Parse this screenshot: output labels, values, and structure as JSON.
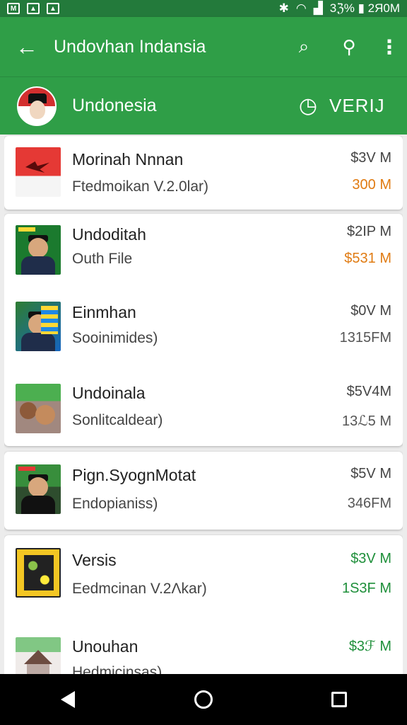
{
  "status_bar": {
    "icons": [
      "notification-icon",
      "image-icon",
      "gallery-icon"
    ],
    "right_text": "3ℨ% ▮ 2Я0M"
  },
  "app_bar": {
    "back_icon": "arrow-left-icon",
    "title": "Undovhan Indansia",
    "actions": [
      "search-icon",
      "search-icon",
      "more-vert-icon"
    ]
  },
  "sub_bar": {
    "name": "Undonesia",
    "chat_icon": "chat-icon",
    "verify": "VERIJ"
  },
  "items": [
    {
      "title": "Morinah Nnnan",
      "subtitle": "Ftedmoikan V.2.0lar)",
      "price1": "$3V M",
      "price2": "300 M",
      "price2_color": "orange"
    },
    {
      "title": "Undoditah",
      "subtitle": "Outh File",
      "price1": "$2ΙΡ M",
      "price2": "$531 M",
      "price2_color": "orange"
    },
    {
      "title": "Einmhan",
      "subtitle": "Sooinimides)",
      "price1": "$0V M",
      "price2": "1315FM",
      "price2_color": "gray"
    },
    {
      "title": "Undoinala",
      "subtitle": "Sonlitcaldear)",
      "price1": "$5V4M",
      "price2": "13ℒ5 M",
      "price2_color": "gray"
    },
    {
      "title": "Pign.SyognMotat",
      "subtitle": "Endopianiss)",
      "price1": "$5V M",
      "price2": "346FM",
      "price2_color": "gray"
    },
    {
      "title": "Versis",
      "subtitle": "Eedmcinan V.2Λkar)",
      "price1": "$3V M",
      "price2": "1S3F M",
      "price2_color": "green"
    },
    {
      "title": "Unouhan",
      "subtitle": "Hedmicinsas)",
      "price1": "$3ℱ M",
      "price2": "",
      "price2_color": "green"
    }
  ],
  "nav_bar": {
    "buttons": [
      "back-icon",
      "home-icon",
      "recents-icon"
    ]
  }
}
